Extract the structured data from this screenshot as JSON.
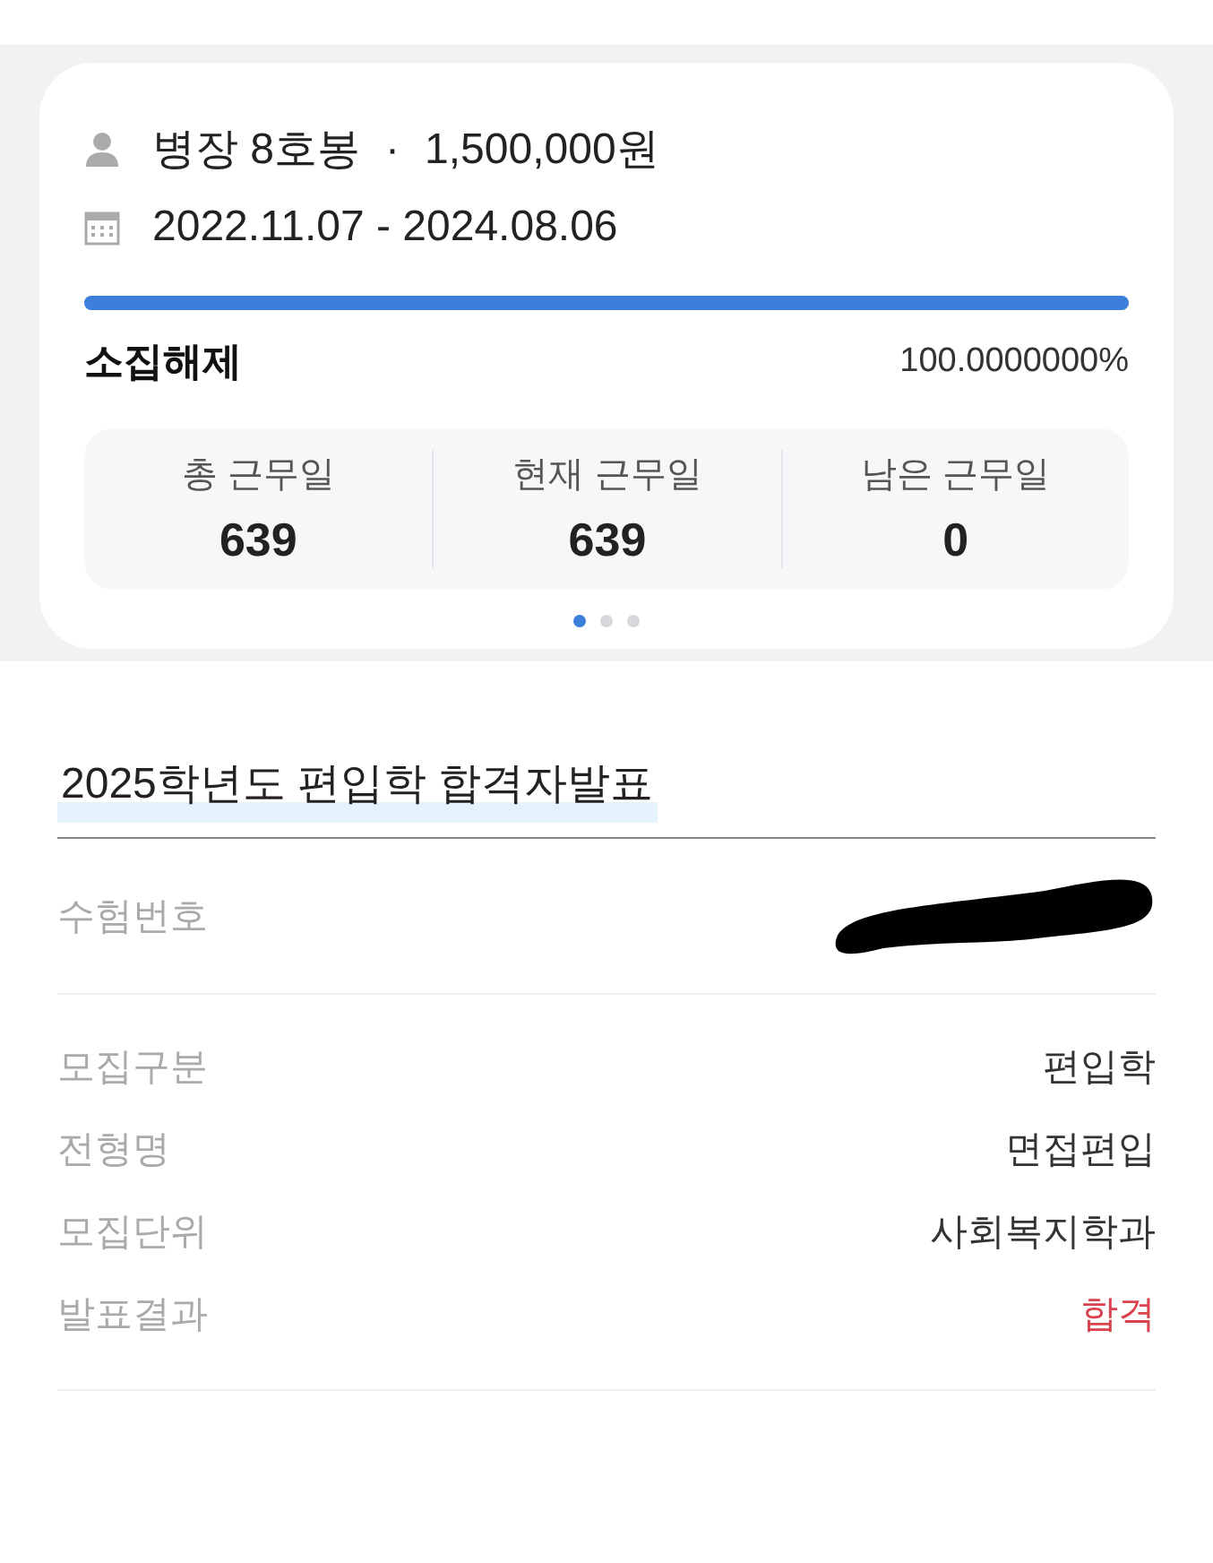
{
  "service_card": {
    "rank": "병장 8호봉",
    "separator": "·",
    "pay": "1,500,000원",
    "period": "2022.11.07 - 2024.08.06",
    "progress": {
      "level": 1.0
    },
    "status": "소집해제",
    "percent": "100.0000000%",
    "stats": [
      {
        "label": "총 근무일",
        "value": "639"
      },
      {
        "label": "현재 근무일",
        "value": "639"
      },
      {
        "label": "남은 근무일",
        "value": "0"
      }
    ],
    "pages": [
      {
        "selected": true
      },
      {
        "selected": false
      },
      {
        "selected": false
      }
    ]
  },
  "result": {
    "title": "2025학년도 편입학 합격자발표",
    "id_row": {
      "label": "수험번호",
      "redacted": true
    },
    "rows": [
      {
        "label": "모집구분",
        "value": "편입학",
        "emphasis": false
      },
      {
        "label": "전형명",
        "value": "면접편입",
        "emphasis": false
      },
      {
        "label": "모집단위",
        "value": "사회복지학과",
        "emphasis": false
      },
      {
        "label": "발표결과",
        "value": "합격",
        "emphasis": true
      }
    ]
  }
}
